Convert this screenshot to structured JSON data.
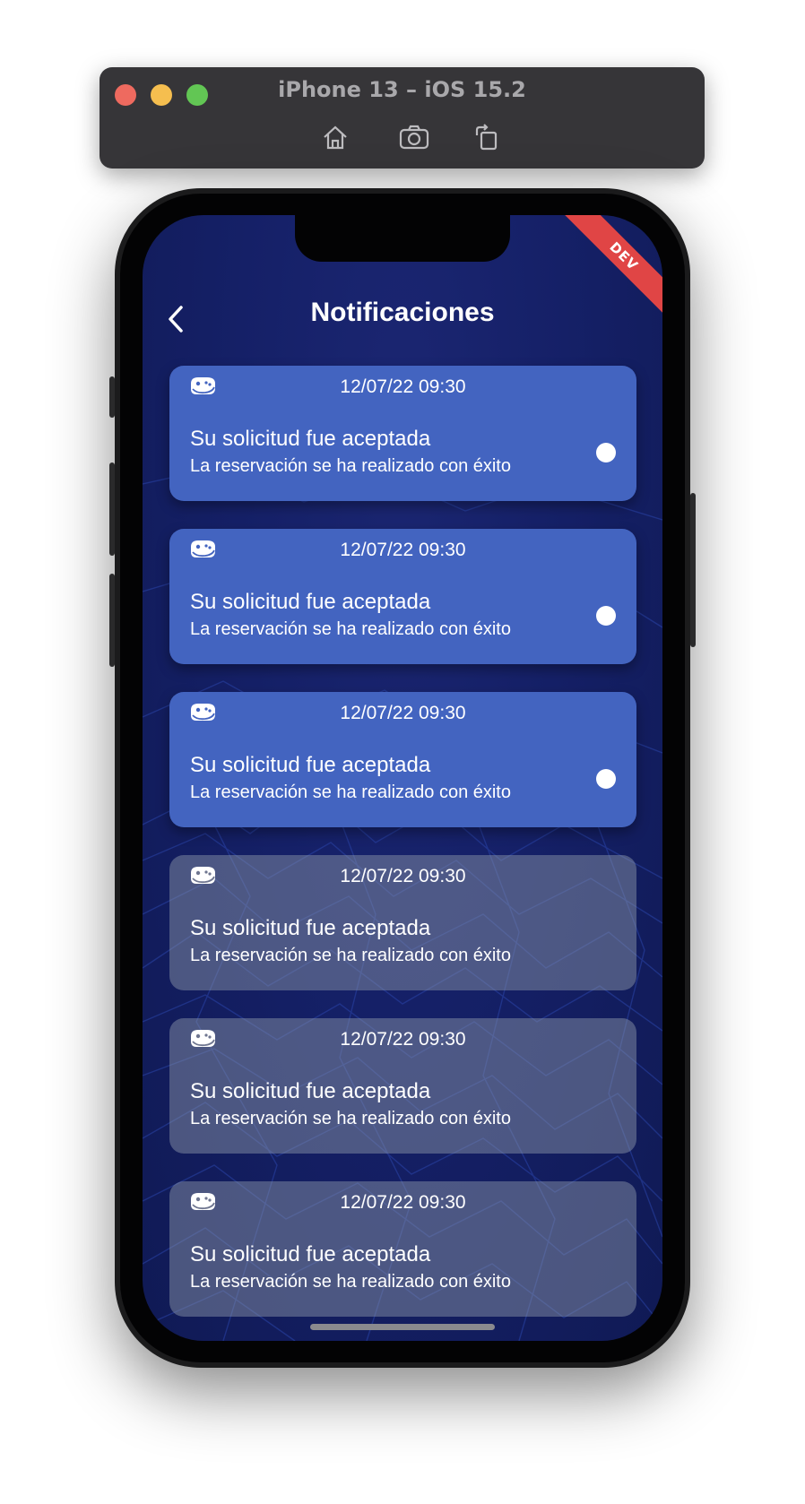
{
  "simulator": {
    "title": "iPhone 13 – iOS 15.2",
    "tools": [
      {
        "icon": "home-icon"
      },
      {
        "icon": "screenshot-icon"
      },
      {
        "icon": "rotate-icon"
      }
    ]
  },
  "app": {
    "banner": "DEV",
    "title": "Notificaciones",
    "back_icon": "chevron-left-icon",
    "colors": {
      "background": "#152067",
      "unread_card": "#4364c0",
      "read_card": "#5b6381",
      "banner": "#e04545"
    },
    "notifications": [
      {
        "icon": "controller-icon",
        "date": "12/07/22 09:30",
        "title": "Su solicitud fue aceptada",
        "body": "La reservación se ha realizado con éxito",
        "unread": true
      },
      {
        "icon": "controller-icon",
        "date": "12/07/22 09:30",
        "title": "Su solicitud fue aceptada",
        "body": "La reservación se ha realizado con éxito",
        "unread": true
      },
      {
        "icon": "controller-icon",
        "date": "12/07/22 09:30",
        "title": "Su solicitud fue aceptada",
        "body": "La reservación se ha realizado con éxito",
        "unread": true
      },
      {
        "icon": "controller-icon",
        "date": "12/07/22 09:30",
        "title": "Su solicitud fue aceptada",
        "body": "La reservación se ha realizado con éxito",
        "unread": false
      },
      {
        "icon": "controller-icon",
        "date": "12/07/22 09:30",
        "title": "Su solicitud fue aceptada",
        "body": "La reservación se ha realizado con éxito",
        "unread": false
      },
      {
        "icon": "controller-icon",
        "date": "12/07/22 09:30",
        "title": "Su solicitud fue aceptada",
        "body": "La reservación se ha realizado con éxito",
        "unread": false
      }
    ]
  }
}
